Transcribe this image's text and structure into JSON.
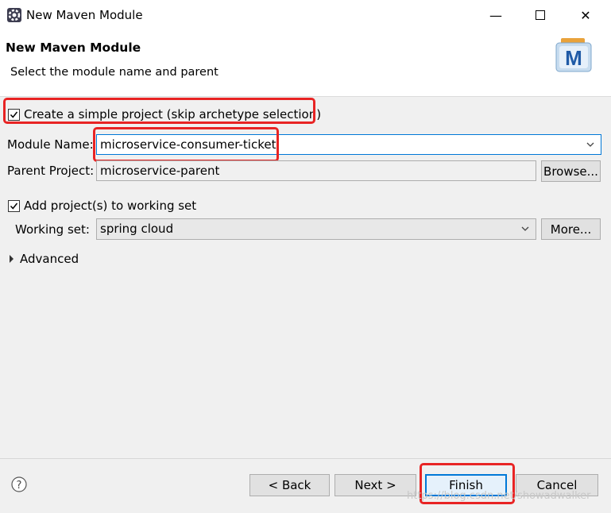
{
  "window": {
    "title": "New Maven Module",
    "minimize": "—",
    "close": "✕"
  },
  "header": {
    "title": "New Maven Module",
    "subtitle": "Select the module name and parent",
    "icon_letter": "M"
  },
  "form": {
    "simple_project": {
      "checked": true,
      "label": "Create a simple project (skip archetype selection)"
    },
    "module_name": {
      "label": "Module Name:",
      "value": "microservice-consumer-ticket"
    },
    "parent_project": {
      "label": "Parent Project:",
      "value": "microservice-parent",
      "browse_label": "Browse..."
    },
    "add_working_set": {
      "checked": true,
      "label": "Add project(s) to working set"
    },
    "working_set": {
      "label": "Working set:",
      "value": "spring cloud",
      "more_label": "More..."
    },
    "advanced": {
      "label": "Advanced"
    }
  },
  "buttons": {
    "back": "< Back",
    "next": "Next >",
    "finish": "Finish",
    "cancel": "Cancel"
  },
  "watermark": "https://blog.csdn.net/showadwalker",
  "colors": {
    "highlight": "#e82424",
    "default_button_border": "#0078d7"
  }
}
